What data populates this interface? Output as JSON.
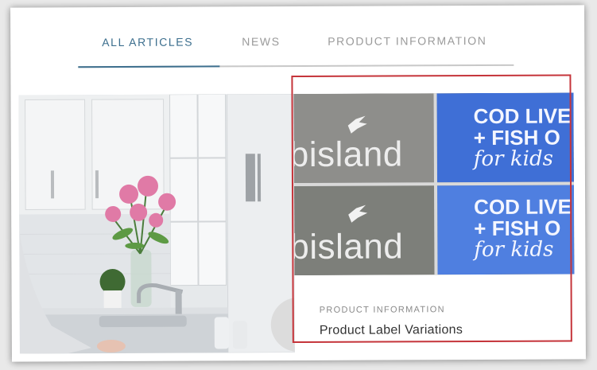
{
  "tabs": [
    {
      "label": "ALL ARTICLES",
      "active": true
    },
    {
      "label": "NEWS",
      "active": false
    },
    {
      "label": "PRODUCT INFORMATION",
      "active": false
    }
  ],
  "colors": {
    "accent": "#3d6f8e",
    "highlight": "#c5343a",
    "label_blue": "#3f6fd6"
  },
  "product_card": {
    "category": "PRODUCT INFORMATION",
    "title": "Product Label Variations",
    "label_brand": "bisland",
    "label_lines": [
      "COD LIVE",
      "+ FISH O",
      "for kids"
    ]
  }
}
